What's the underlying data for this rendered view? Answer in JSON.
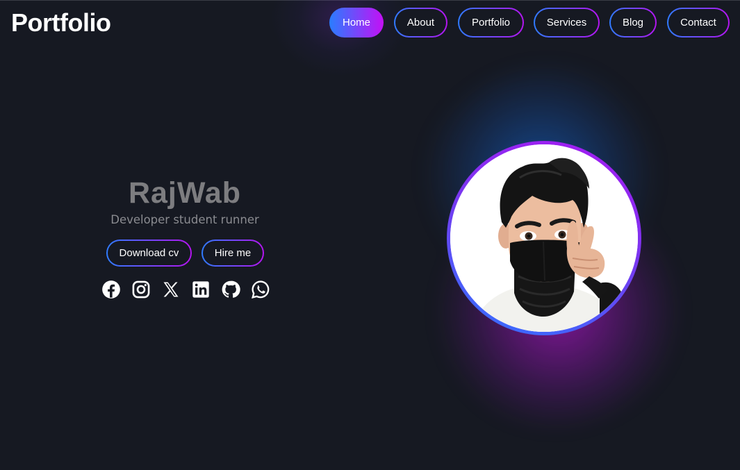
{
  "brand": {
    "logo_text": "Portfolio"
  },
  "nav": {
    "items": [
      {
        "label": "Home",
        "active": true
      },
      {
        "label": "About",
        "active": false
      },
      {
        "label": "Portfolio",
        "active": false
      },
      {
        "label": "Services",
        "active": false
      },
      {
        "label": "Blog",
        "active": false
      },
      {
        "label": "Contact",
        "active": false
      }
    ]
  },
  "hero": {
    "name": "RajWab",
    "tagline": "Developer student runner",
    "buttons": {
      "download_cv": "Download cv",
      "hire_me": "Hire me"
    },
    "socials": [
      "facebook-icon",
      "instagram-icon",
      "x-icon",
      "linkedin-icon",
      "github-icon",
      "whatsapp-icon"
    ]
  },
  "avatar": {
    "icon": "memoji-avatar"
  },
  "colors": {
    "background": "#161922",
    "accent_blue": "#2f7bff",
    "accent_purple": "#b414f0",
    "name_text": "#7d7d80",
    "tagline_text": "#8a8b90"
  }
}
